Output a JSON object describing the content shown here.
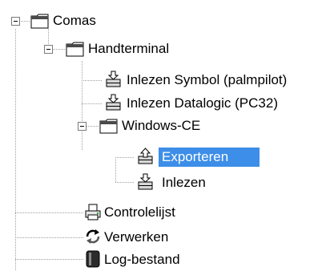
{
  "tree": {
    "root": {
      "label": "Comas",
      "icon": "folder-icon",
      "expanded": true
    },
    "handterminal": {
      "label": "Handterminal",
      "icon": "folder-icon",
      "expanded": true
    },
    "inlezen_symbol": {
      "label": "Inlezen Symbol (palmpilot)",
      "icon": "import-icon"
    },
    "inlezen_datalogic": {
      "label": "Inlezen Datalogic (PC32)",
      "icon": "import-icon"
    },
    "windows_ce": {
      "label": "Windows-CE",
      "icon": "folder-icon",
      "expanded": true
    },
    "exporteren": {
      "label": "Exporteren",
      "icon": "export-icon",
      "selected": true
    },
    "inlezen": {
      "label": "Inlezen",
      "icon": "import-icon"
    },
    "controlelijst": {
      "label": "Controlelijst",
      "icon": "printer-icon"
    },
    "verwerken": {
      "label": "Verwerken",
      "icon": "process-icon"
    },
    "log_bestand": {
      "label": "Log-bestand",
      "icon": "log-icon"
    }
  },
  "colors": {
    "selection": "#3d8ee8",
    "tree_line": "#a0a0a0",
    "folder_outline": "#000000"
  }
}
